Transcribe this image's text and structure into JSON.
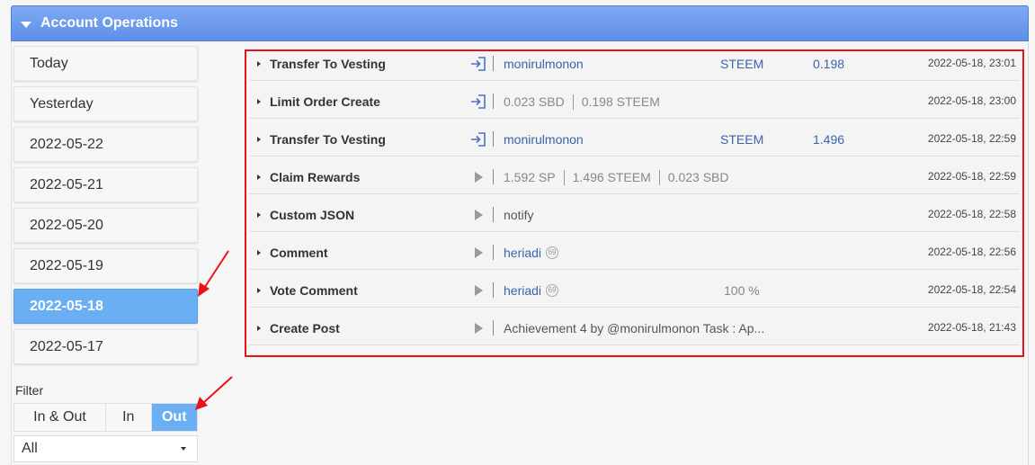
{
  "header": {
    "title": "Account Operations"
  },
  "sidebar": {
    "dates": [
      "Today",
      "Yesterday",
      "2022-05-22",
      "2022-05-21",
      "2022-05-20",
      "2022-05-19",
      "2022-05-18",
      "2022-05-17"
    ],
    "active_date": "2022-05-18"
  },
  "filter": {
    "label": "Filter",
    "options": [
      "In & Out",
      "In",
      "Out"
    ],
    "active": "Out",
    "select_value": "All"
  },
  "operations": [
    {
      "name": "Transfer To Vesting",
      "icon": "login-arrow-icon",
      "account": "monirulmonon",
      "asset": "STEEM",
      "amount": "0.198",
      "time": "2022-05-18, 23:01"
    },
    {
      "name": "Limit Order Create",
      "icon": "login-arrow-icon",
      "amount1": "0.023 SBD",
      "amount2": "0.198 STEEM",
      "time": "2022-05-18, 23:00"
    },
    {
      "name": "Transfer To Vesting",
      "icon": "login-arrow-icon",
      "account": "monirulmonon",
      "asset": "STEEM",
      "amount": "1.496",
      "time": "2022-05-18, 22:59"
    },
    {
      "name": "Claim Rewards",
      "icon": "play-icon",
      "r1": "1.592 SP",
      "r2": "1.496 STEEM",
      "r3": "0.023 SBD",
      "time": "2022-05-18, 22:59"
    },
    {
      "name": "Custom JSON",
      "icon": "play-icon",
      "detail": "notify",
      "time": "2022-05-18, 22:58"
    },
    {
      "name": "Comment",
      "icon": "play-icon",
      "account": "heriadi",
      "badge": "69",
      "time": "2022-05-18, 22:56"
    },
    {
      "name": "Vote Comment",
      "icon": "play-icon",
      "account": "heriadi",
      "badge": "69",
      "weight": "100 %",
      "time": "2022-05-18, 22:54"
    },
    {
      "name": "Create Post",
      "icon": "play-icon",
      "detail": "Achievement 4 by @monirulmonon Task : Ap...",
      "time": "2022-05-18, 21:43"
    }
  ],
  "colors": {
    "header": "#6a99ed",
    "active": "#6aaef3",
    "link": "#3d62a8",
    "highlight": "#e8131a"
  }
}
